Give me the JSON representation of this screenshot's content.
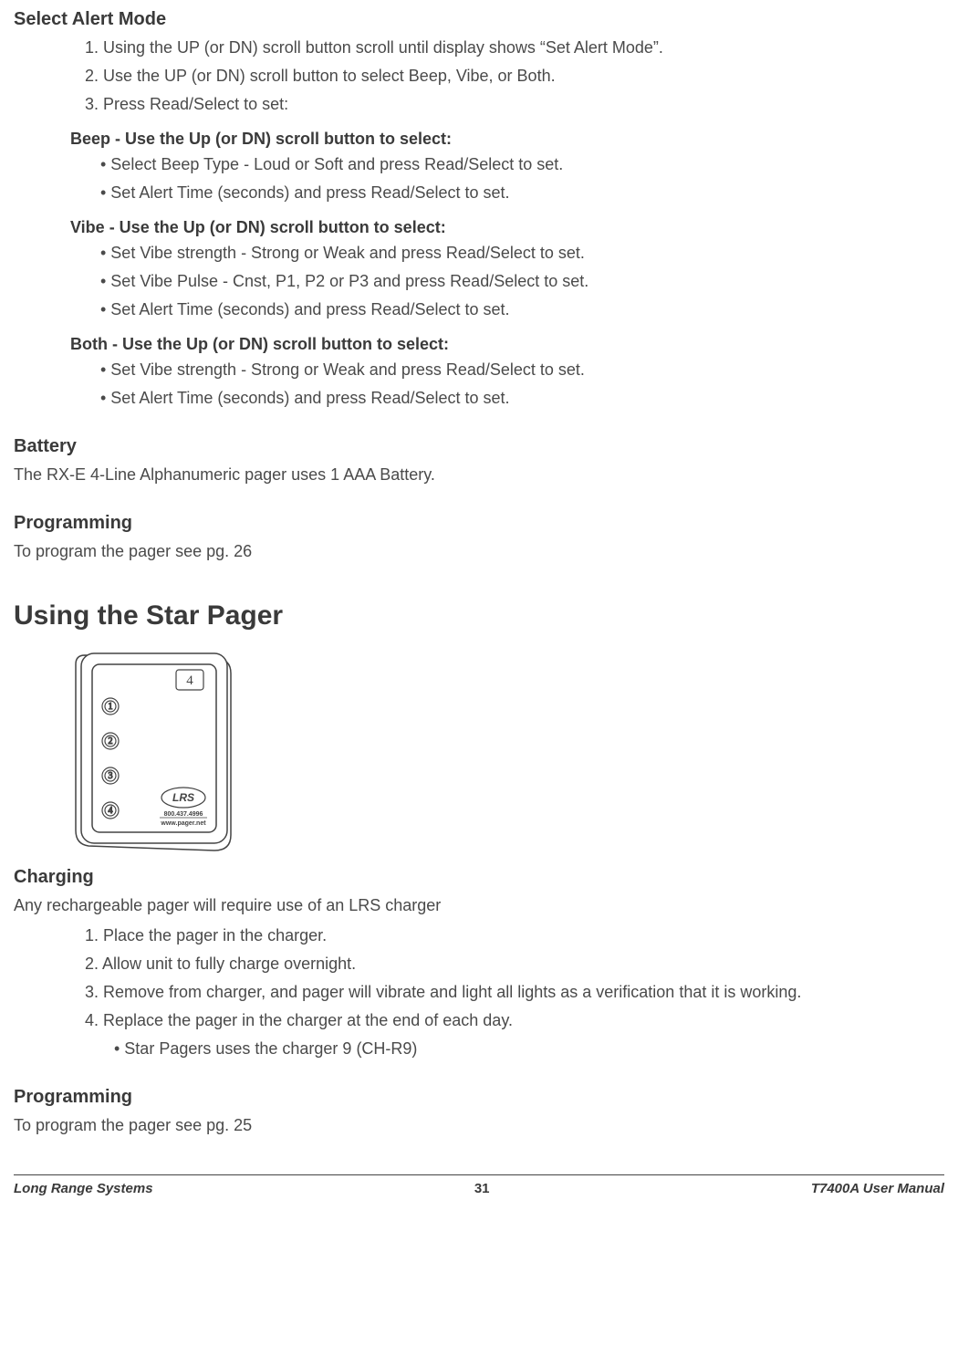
{
  "sections": {
    "selectAlertMode": {
      "title": "Select Alert Mode",
      "steps": [
        "1. Using the UP (or DN) scroll button scroll until display shows “Set Alert Mode”.",
        "2. Use the UP (or DN) scroll button to select Beep, Vibe, or Both.",
        "3. Press Read/Select to set:"
      ],
      "beep": {
        "title": "Beep - Use the Up (or DN) scroll button to select:",
        "items": [
          "• Select Beep Type - Loud or Soft and press Read/Select to set.",
          "• Set Alert Time (seconds) and press Read/Select to set."
        ]
      },
      "vibe": {
        "title": "Vibe - Use the Up (or DN) scroll button to select:",
        "items": [
          "• Set Vibe strength - Strong or Weak and press Read/Select to set.",
          "• Set Vibe Pulse - Cnst, P1, P2 or P3 and press Read/Select to set.",
          "• Set Alert Time (seconds) and press Read/Select to set."
        ]
      },
      "both": {
        "title": "Both - Use the Up (or DN) scroll button to select:",
        "items": [
          "• Set Vibe strength - Strong or Weak and press Read/Select to set.",
          "• Set Alert Time (seconds) and press Read/Select to set."
        ]
      }
    },
    "battery": {
      "title": "Battery",
      "text": "The RX-E 4-Line Alphanumeric pager uses 1 AAA Battery."
    },
    "programming1": {
      "title": "Programming",
      "text": "To program the pager see pg. 26"
    },
    "starPager": {
      "title": "Using the Star Pager"
    },
    "charging": {
      "title": "Charging",
      "intro": "Any rechargeable pager will require use of an LRS charger",
      "steps": [
        "1. Place the pager in the charger.",
        "2. Allow unit to fully charge overnight.",
        "3. Remove from charger, and pager will vibrate and light all lights as a verification that it is working.",
        "4. Replace the pager in the charger at the end of each day."
      ],
      "substep": "• Star Pagers uses the charger 9 (CH-R9)"
    },
    "programming2": {
      "title": "Programming",
      "text": "To program the pager see pg. 25"
    }
  },
  "pager": {
    "cornerNumber": "4",
    "lights": [
      "1",
      "2",
      "3",
      "4"
    ],
    "logo": "LRS",
    "phone": "800.437.4996",
    "url": "www.pager.net"
  },
  "footer": {
    "left": "Long Range Systems",
    "center": "31",
    "right": "T7400A User Manual"
  }
}
